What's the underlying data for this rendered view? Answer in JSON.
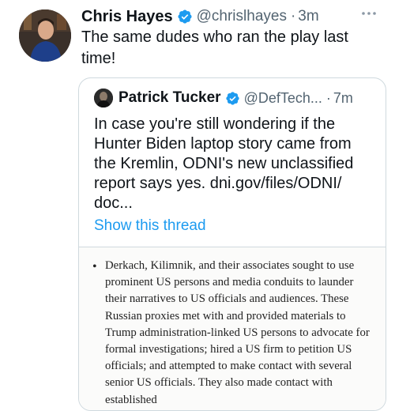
{
  "tweet": {
    "author_name": "Chris Hayes",
    "handle": "@chrislhayes",
    "separator": "·",
    "time": "3m",
    "text": "The same dudes who ran the play last time!",
    "verified_icon": "verified-badge-icon",
    "more_icon": "more-options-icon"
  },
  "quoted_tweet": {
    "author_name": "Patrick Tucker",
    "handle": "@DefTech...",
    "separator": "·",
    "time": "7m",
    "text": "In case you're still wondering if the Hunter Biden laptop story came from the Kremlin, ODNI's new unclassified report says yes. dni.gov/files/ODNI/ doc...",
    "show_thread_label": "Show this thread",
    "verified_icon": "verified-badge-icon"
  },
  "document_image": {
    "bullet": "•",
    "text": "Derkach, Kilimnik, and their associates sought to use prominent US persons and media conduits to launder their narratives to US officials and audiences. These Russian proxies met with and provided materials to Trump administration-linked US persons to advocate for formal investigations; hired a US firm to petition US officials; and attempted to make contact with several senior US officials. They also made contact with established"
  },
  "colors": {
    "accent": "#1d9bf0",
    "text_primary": "#0f1419",
    "text_secondary": "#536471",
    "border": "#cfd9de"
  }
}
